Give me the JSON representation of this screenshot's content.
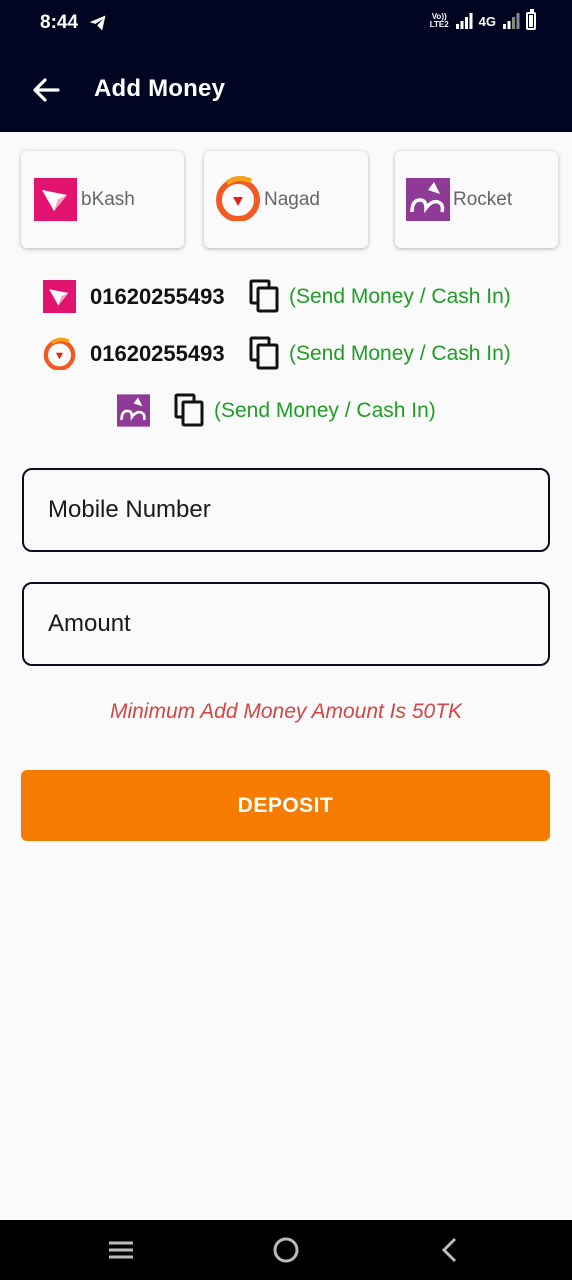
{
  "status": {
    "time": "8:44",
    "network_top": "Vo))",
    "network_bottom": "LTE2",
    "network": "4G"
  },
  "app_bar": {
    "title": "Add Money"
  },
  "methods": [
    {
      "label": "bKash",
      "color": "#e2136e"
    },
    {
      "label": "Nagad",
      "color": "#f15a22"
    },
    {
      "label": "Rocket",
      "color": "#8e3a96"
    }
  ],
  "accounts": [
    {
      "number": "01620255493",
      "note": "(Send Money / Cash In)"
    },
    {
      "number": "01620255493",
      "note": "(Send Money / Cash In)"
    },
    {
      "number": "",
      "note": "(Send Money / Cash In)"
    }
  ],
  "form": {
    "mobile_placeholder": "Mobile Number",
    "amount_placeholder": "Amount",
    "min_note": "Minimum Add Money Amount Is 50TK",
    "deposit_label": "DEPOSIT"
  },
  "colors": {
    "appbar": "#020522",
    "accent": "#f57c00",
    "green": "#1e9e24",
    "warn": "#d64545"
  }
}
